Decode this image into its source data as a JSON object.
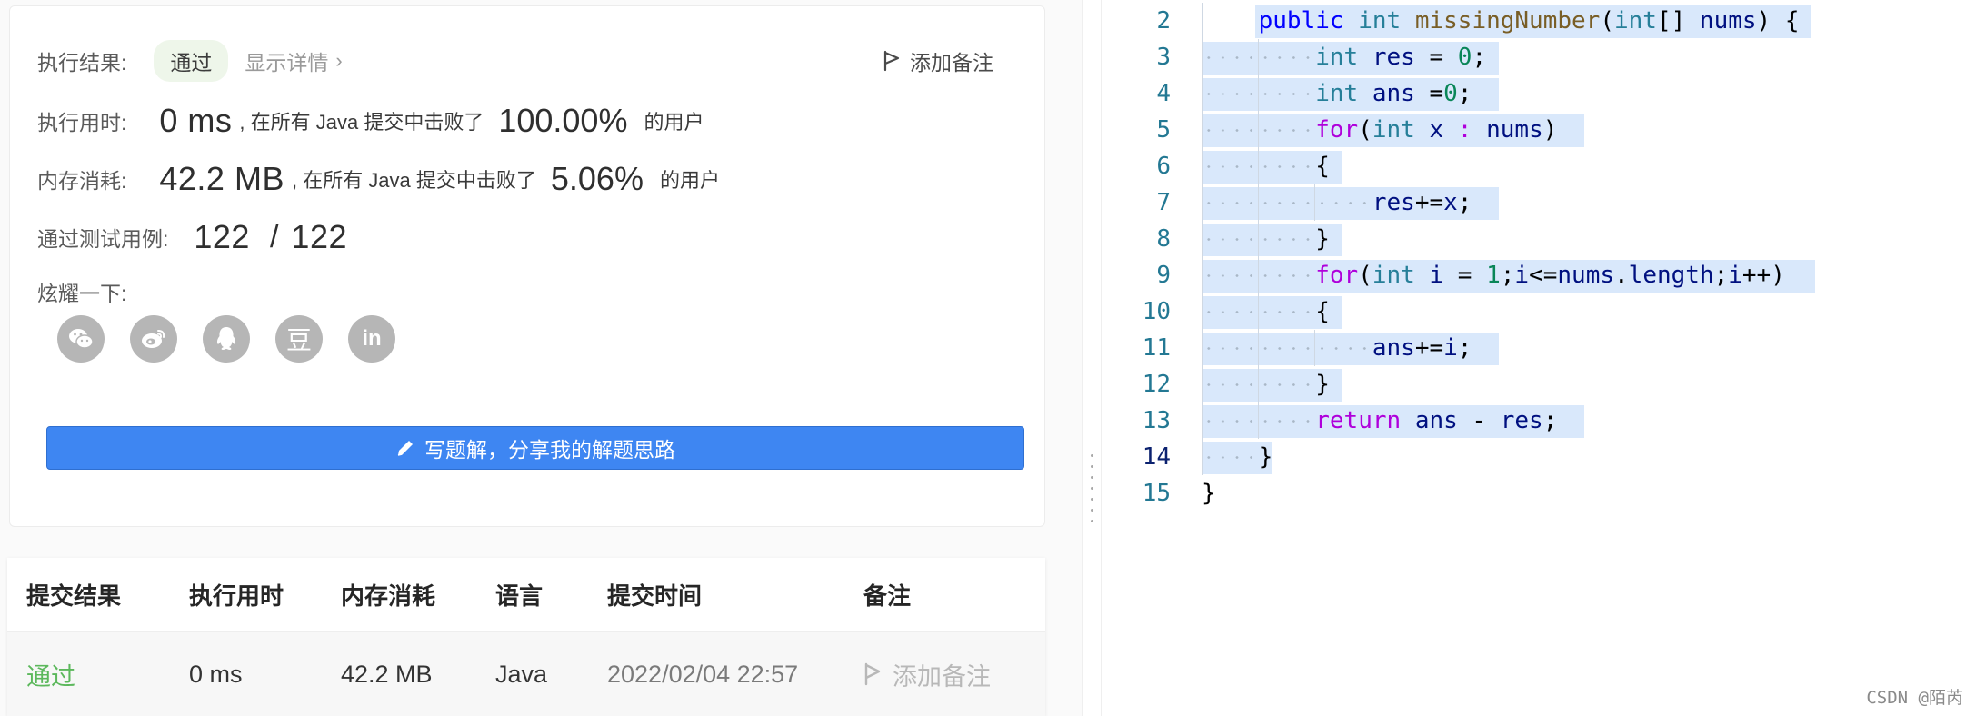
{
  "result_card": {
    "status_label": "执行结果:",
    "status_value": "通过",
    "details_link": "显示详情",
    "add_note": "添加备注",
    "runtime_label": "执行用时:",
    "runtime_value": "0 ms",
    "runtime_text": ", 在所有 Java 提交中击败了",
    "runtime_percent": "100.00%",
    "runtime_suffix": "的用户",
    "memory_label": "内存消耗:",
    "memory_value": "42.2 MB",
    "memory_text": ", 在所有 Java 提交中击败了",
    "memory_percent": "5.06%",
    "memory_suffix": "的用户",
    "tests_label": "通过测试用例:",
    "tests_passed": "122",
    "tests_sep": "/",
    "tests_total": "122",
    "share_label": "炫耀一下:",
    "share_icons": [
      "wechat-icon",
      "weibo-icon",
      "qq-icon",
      "douban-icon",
      "linkedin-icon"
    ],
    "douban_glyph": "豆",
    "linkedin_glyph": "in",
    "solution_button": "写题解，分享我的解题思路"
  },
  "submissions": {
    "headers": [
      "提交结果",
      "执行用时",
      "内存消耗",
      "语言",
      "提交时间",
      "备注"
    ],
    "rows": [
      {
        "result": "通过",
        "runtime": "0 ms",
        "memory": "42.2 MB",
        "language": "Java",
        "time": "2022/02/04 22:57",
        "note": "添加备注"
      }
    ]
  },
  "editor": {
    "line_numbers": [
      "2",
      "3",
      "4",
      "5",
      "6",
      "7",
      "8",
      "9",
      "10",
      "11",
      "12",
      "13",
      "14",
      "15"
    ],
    "active_line": "14",
    "lines": [
      "    public int missingNumber(int[] nums) {",
      "        int res = 0;",
      "        int ans =0;",
      "        for(int x : nums)",
      "        {",
      "            res+=x;",
      "        }",
      "        for(int i = 1;i<=nums.length;i++)",
      "        {",
      "            ans+=i;",
      "        }",
      "        return ans - res;",
      "    }",
      "}"
    ]
  },
  "watermark": "CSDN @陌芮",
  "colors": {
    "accent": "#3e86f2",
    "pass_green": "#5cb85c",
    "selection": "#d9e8fb"
  }
}
